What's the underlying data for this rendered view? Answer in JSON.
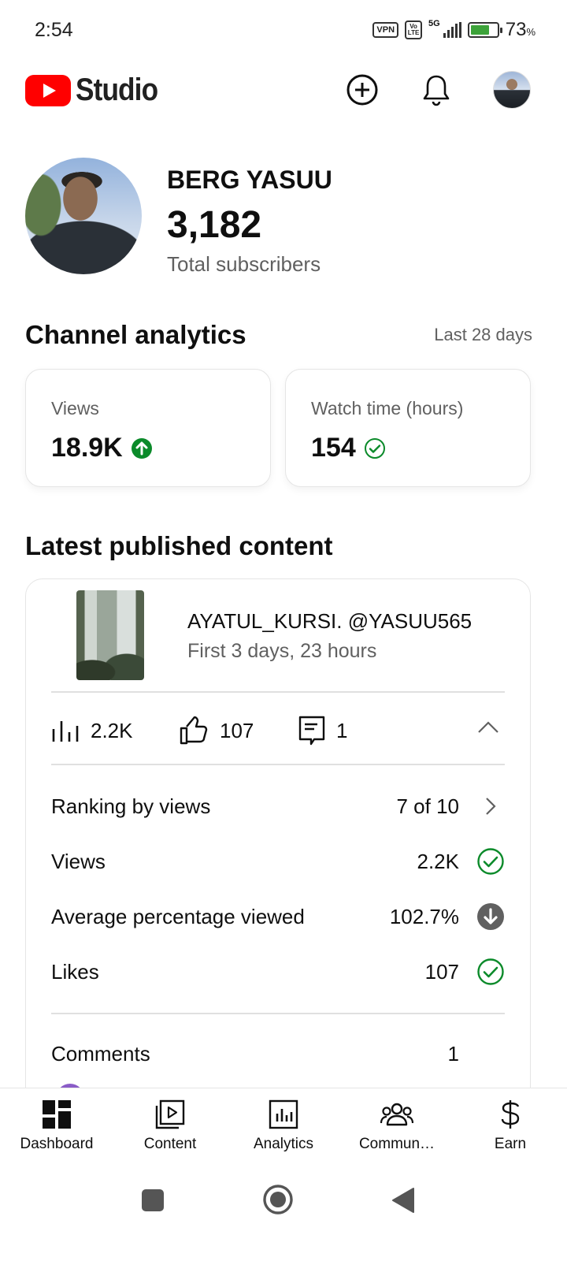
{
  "status_bar": {
    "time": "2:54",
    "vpn": "VPN",
    "volte": "Vo LTE",
    "network": "5G",
    "battery_percent": "73",
    "battery_unit": "%",
    "battery_level": 0.73
  },
  "app_bar": {
    "logo_text": "Studio",
    "actions": [
      "create-icon",
      "notifications-icon",
      "account-avatar"
    ]
  },
  "channel": {
    "name": "BERG YASUU",
    "subscribers": "3,182",
    "subscribers_label": "Total subscribers"
  },
  "analytics": {
    "title": "Channel analytics",
    "period": "Last 28 days",
    "cards": [
      {
        "label": "Views",
        "value": "18.9K",
        "status_icon": "arrow-up-circle-icon"
      },
      {
        "label": "Watch time (hours)",
        "value": "154",
        "status_icon": "check-circle-icon"
      }
    ]
  },
  "latest": {
    "title": "Latest published content",
    "video": {
      "title": "AYATUL_KURSI. @YASUU565",
      "subtitle": "First 3 days, 23 hours"
    },
    "summary": {
      "views": "2.2K",
      "likes": "107",
      "comments": "1"
    },
    "metrics": [
      {
        "label": "Ranking by views",
        "value": "7 of 10",
        "icon": "chevron-right-icon"
      },
      {
        "label": "Views",
        "value": "2.2K",
        "icon": "check-circle-icon"
      },
      {
        "label": "Average percentage viewed",
        "value": "102.7%",
        "icon": "arrow-down-circle-icon"
      },
      {
        "label": "Likes",
        "value": "107",
        "icon": "check-circle-icon"
      }
    ],
    "comments_row": {
      "label": "Comments",
      "value": "1"
    }
  },
  "bottom_nav": [
    {
      "label": "Dashboard",
      "icon": "dashboard-icon"
    },
    {
      "label": "Content",
      "icon": "content-icon"
    },
    {
      "label": "Analytics",
      "icon": "analytics-icon"
    },
    {
      "label": "Commun…",
      "icon": "community-icon"
    },
    {
      "label": "Earn",
      "icon": "earn-icon"
    }
  ],
  "colors": {
    "brand_red": "#ff0000",
    "success_green": "#0b8a2a",
    "text_primary": "#0f0f0f",
    "text_secondary": "#606060"
  }
}
